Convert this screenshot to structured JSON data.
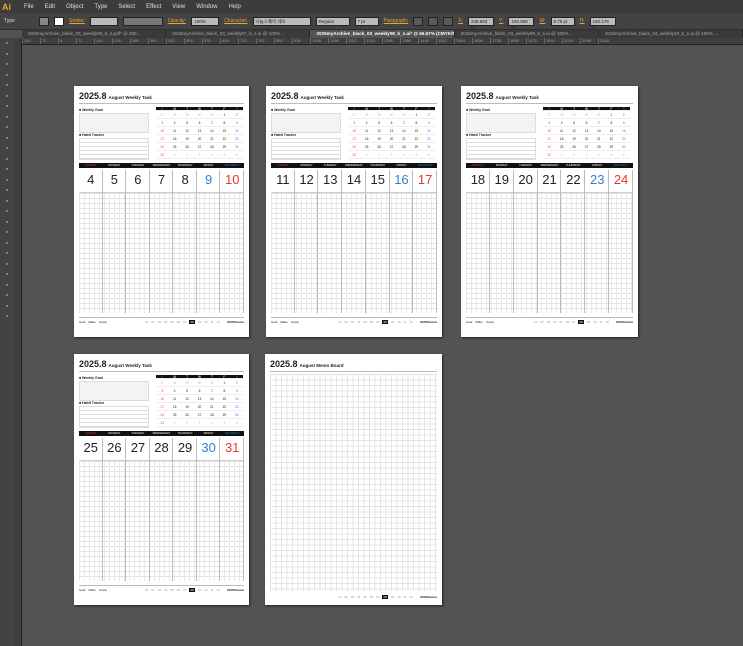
{
  "app": {
    "logo": "Ai",
    "menus": [
      "File",
      "Edit",
      "Object",
      "Type",
      "Select",
      "Effect",
      "View",
      "Window",
      "Help"
    ]
  },
  "control": {
    "type_label": "Type",
    "stroke_label": "Stroke:",
    "opacity_label": "Opacity:",
    "opacity": "100%",
    "character_label": "Character:",
    "font": "나눔스퀘어 네오",
    "style": "Regular",
    "size": "7 pt",
    "paragraph_label": "Paragraph:",
    "x_label": "X:",
    "x": "236.693 pt",
    "y_label": "Y:",
    "y": "160.868 pt",
    "w_label": "W:",
    "w": "8.75 pt",
    "h_label": "H:",
    "h": "150.179 pt"
  },
  "tabs": [
    "2025myArchive_black_03_weekly06_b_s.pdf* @ 200...",
    "2025myArchive_black_03_weekly07_b_s.ai @ 100% ...",
    "2025myArchive_black_03_weekly08_b_s.ai* @ 66.67% (CMYK/Preview)",
    "2025myArchive_black_03_weekly09_b_s.ai @ 100% ...",
    "2025myArchive_black_03_weekly10_b_s.ai @ 100% ..."
  ],
  "ruler": [
    "144",
    "72",
    "0",
    "72",
    "144",
    "216",
    "288",
    "360",
    "432",
    "504",
    "576",
    "648",
    "720",
    "792",
    "864",
    "936",
    "1008",
    "1080",
    "1152",
    "1224",
    "1296",
    "1368",
    "1440",
    "1512",
    "1584",
    "1656",
    "1728",
    "1800",
    "1872",
    "1944",
    "2016",
    "2088",
    "2160"
  ],
  "planner": {
    "year": "2025.8",
    "subtitle": "August Weekly Task",
    "goal": "■ Weekly Goal",
    "habit": "■ Habit Tracker",
    "days": [
      "SUNDAY",
      "MONDAY",
      "TUESDAY",
      "WEDNESDAY",
      "THURSDAY",
      "FRIDAY",
      "SATURDAY"
    ],
    "mini_head": [
      "S",
      "M",
      "T",
      "W",
      "T",
      "F",
      "S"
    ],
    "mini": [
      "27",
      "28",
      "29",
      "30",
      "31",
      "1",
      "2",
      "3",
      "4",
      "5",
      "6",
      "7",
      "8",
      "9",
      "10",
      "11",
      "12",
      "13",
      "14",
      "15",
      "16",
      "17",
      "18",
      "19",
      "20",
      "21",
      "22",
      "23",
      "24",
      "25",
      "26",
      "27",
      "28",
      "29",
      "30",
      "31",
      "1",
      "2",
      "3",
      "4",
      "5",
      "6"
    ],
    "footer_left": [
      "Goal",
      "Make",
      "Yearly"
    ],
    "months": [
      "01",
      "02",
      "03",
      "04",
      "05",
      "06",
      "07",
      "08",
      "09",
      "10",
      "11",
      "12"
    ],
    "current_month": "08",
    "footer_right": "2025Review",
    "weeks": [
      [
        "4",
        "5",
        "6",
        "7",
        "8",
        "9",
        "10"
      ],
      [
        "11",
        "12",
        "13",
        "14",
        "15",
        "16",
        "17"
      ],
      [
        "18",
        "19",
        "20",
        "21",
        "22",
        "23",
        "24"
      ],
      [
        "25",
        "26",
        "27",
        "28",
        "29",
        "30",
        "31"
      ]
    ],
    "memo_subtitle": "August Memo Board"
  },
  "colors": {
    "red": "#e8372c",
    "blue": "#2f7fd0"
  }
}
